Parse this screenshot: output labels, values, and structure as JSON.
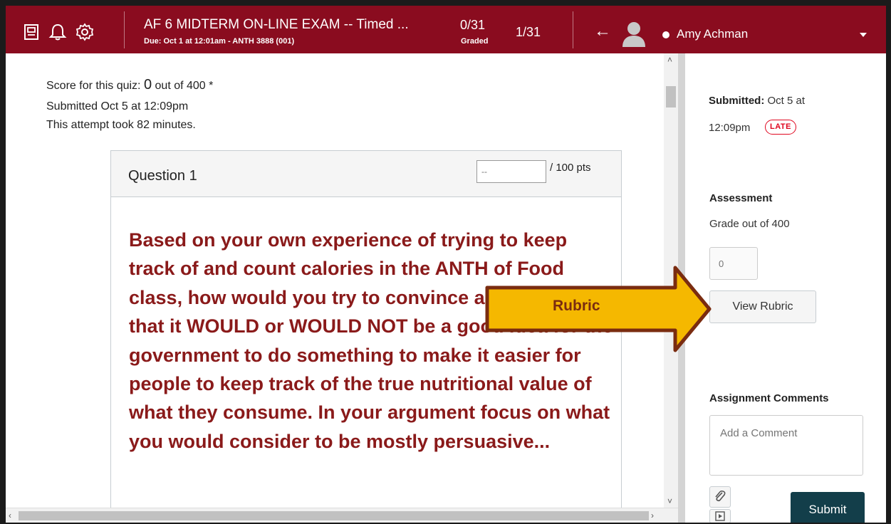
{
  "header": {
    "icons": [
      "gradebook-icon",
      "bell-icon",
      "gear-icon"
    ],
    "assignment_title": "AF 6 MIDTERM ON-LINE EXAM -- Timed ...",
    "due_text": "Due: Oct 1 at 12:01am - ANTH 3888 (001)",
    "graded_count": "0/31",
    "graded_label": "Graded",
    "position": "1/31",
    "student_name": "Amy Achman",
    "color": "#8a0c1f"
  },
  "main": {
    "score_prefix": "Score for this quiz: ",
    "score_value": "0",
    "score_suffix": " out of 400 *",
    "submitted": "Submitted Oct 5 at 12:09pm",
    "duration": "This attempt took 82 minutes.",
    "question": {
      "title": "Question 1",
      "points_placeholder": "--",
      "points_label": "/ 100 pts",
      "text": "Based on your own experience of trying to keep track of and count calories in the ANTH of Food class, how would you try to convince a good friend that it WOULD or WOULD NOT be a good idea for the government to do something to make it easier for people to keep track of the true nutritional value of what they consume. In your argument focus on what you would consider to be mostly persuasive...",
      "text_color": "#8a1a1a"
    }
  },
  "sidebar": {
    "submitted_label": "Submitted:",
    "submitted_date": " Oct 5 at",
    "submitted_time": "12:09pm",
    "late_badge": "LATE",
    "assessment_heading": "Assessment",
    "grade_out_of": "Grade out of 400",
    "grade_value": "0",
    "view_rubric": "View Rubric",
    "comments_heading": "Assignment Comments",
    "comment_placeholder": "Add a Comment",
    "submit_label": "Submit"
  },
  "callout": {
    "label": "Rubric",
    "fill": "#f5b800",
    "stroke": "#7a2c10"
  }
}
